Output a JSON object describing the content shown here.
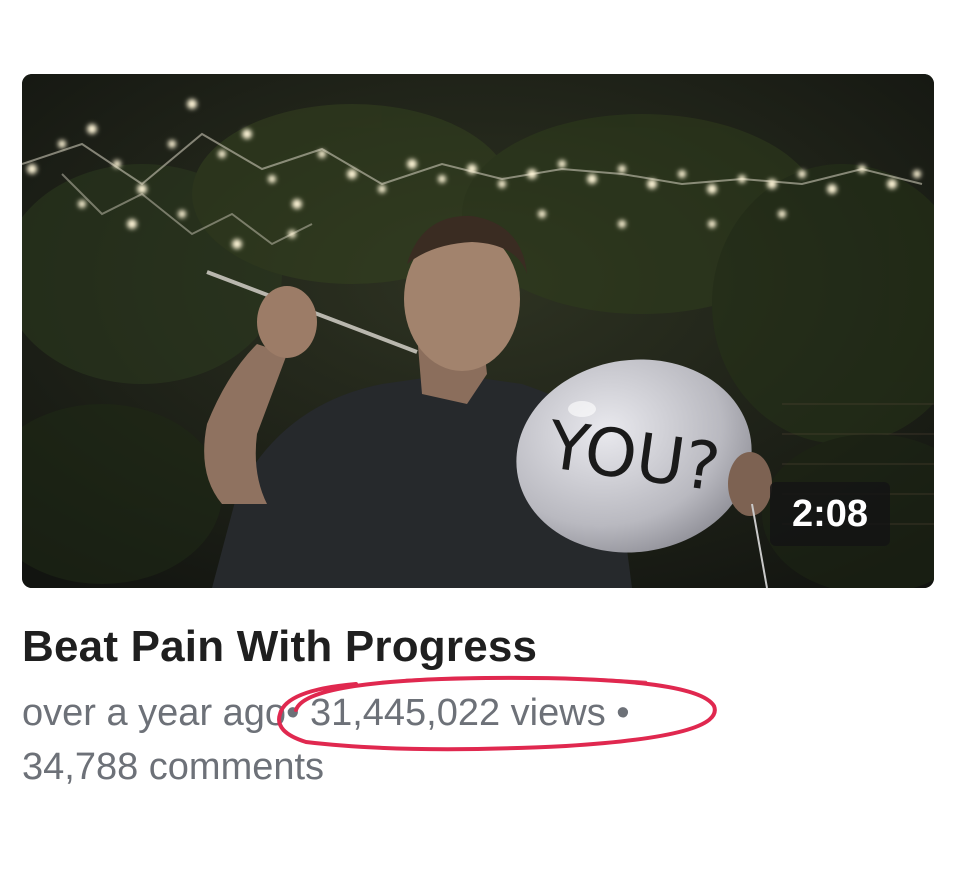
{
  "video": {
    "duration": "2:08",
    "title": "Beat Pain With Progress",
    "posted": "over a year ago",
    "separator": "•",
    "views": "31,445,022 views",
    "comments": "34,788 comments",
    "balloon_text": "YOU?"
  },
  "colors": {
    "highlight_circle": "#e0284f",
    "meta_text": "#6d7178",
    "title_text": "#1f1f1f"
  }
}
